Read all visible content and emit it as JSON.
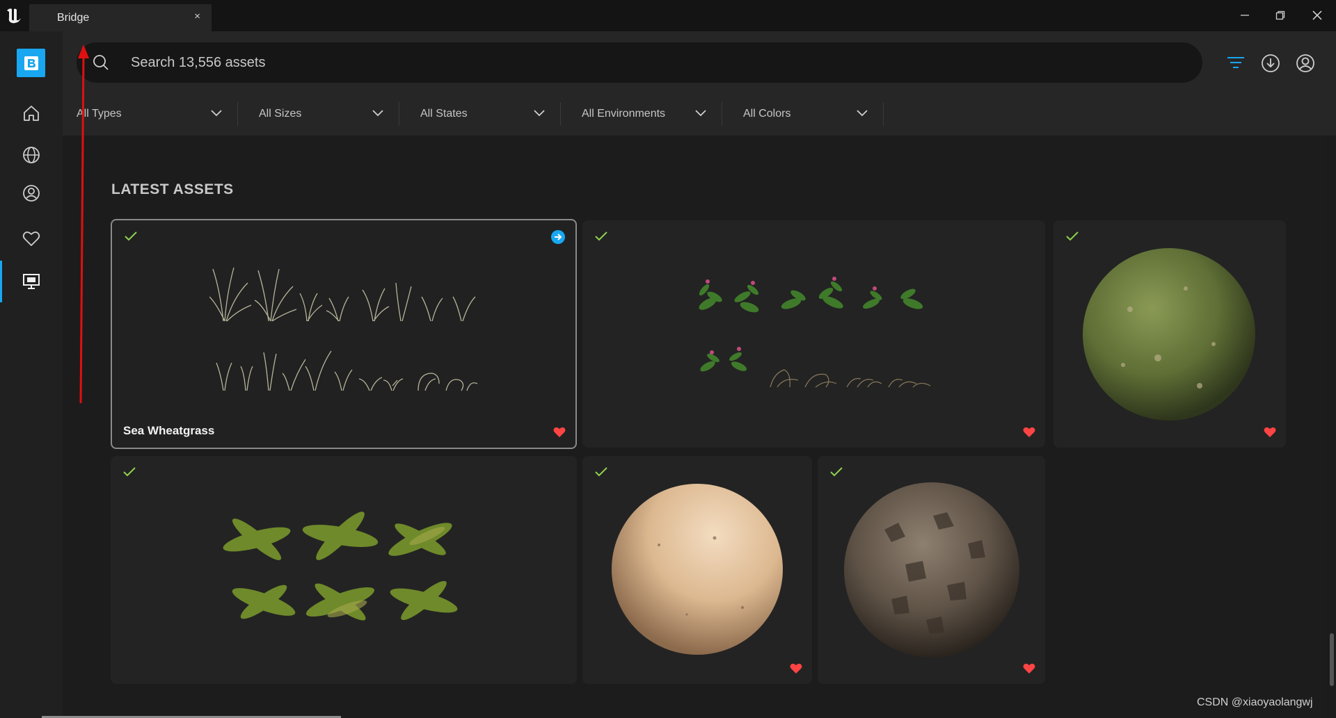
{
  "window": {
    "tab_title": "Bridge",
    "tab_close": "×",
    "minimize_label": "—",
    "restore_label": "❐",
    "close_label": "✕"
  },
  "sidebar": {
    "brand_letter": "B",
    "items": [
      {
        "name": "home",
        "icon": "home-icon"
      },
      {
        "name": "globe",
        "icon": "globe-icon"
      },
      {
        "name": "account",
        "icon": "user-circle-icon"
      },
      {
        "name": "favorites",
        "icon": "heart-icon"
      },
      {
        "name": "local",
        "icon": "monitor-icon",
        "active": true
      }
    ],
    "accent": "#18a7f0"
  },
  "search": {
    "placeholder": "Search 13,556 assets"
  },
  "header_icons": [
    "filter-icon",
    "download-icon",
    "user-circle-icon"
  ],
  "filters": [
    {
      "label": "All Types"
    },
    {
      "label": "All Sizes"
    },
    {
      "label": "All States"
    },
    {
      "label": "All Environments"
    },
    {
      "label": "All Colors"
    }
  ],
  "section": {
    "title": "LATEST ASSETS"
  },
  "assets": [
    {
      "name": "Sea Wheatgrass",
      "selected": true,
      "downloaded": true,
      "favorite": true,
      "kind": "grass"
    },
    {
      "name": "",
      "downloaded": true,
      "favorite": true,
      "kind": "plants"
    },
    {
      "name": "",
      "downloaded": true,
      "favorite": true,
      "kind": "sphere-moss"
    },
    {
      "name": "",
      "downloaded": true,
      "favorite": false,
      "kind": "ferns"
    },
    {
      "name": "",
      "downloaded": true,
      "favorite": true,
      "kind": "sphere-plaster"
    },
    {
      "name": "",
      "downloaded": true,
      "favorite": true,
      "kind": "sphere-rock"
    }
  ],
  "colors": {
    "check": "#8fd14f",
    "heart": "#ff4444",
    "accent": "#18a7f0"
  },
  "watermark": "CSDN @xiaoyaolangwj"
}
